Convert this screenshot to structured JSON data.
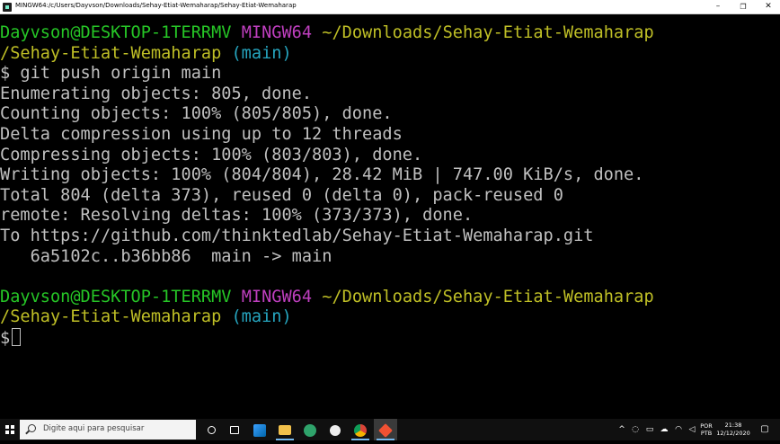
{
  "window": {
    "title": "MINGW64:/c/Users/Dayvson/Downloads/Sehay-Etiat-Wemaharap/Sehay-Etiat-Wemaharap",
    "minimize_label": "–",
    "maximize_label": "❐",
    "close_label": "✕"
  },
  "terminal": {
    "prompt1": {
      "user": "Dayvson@DESKTOP-1TERRMV",
      "shell": "MINGW64",
      "path": "~/Downloads/Sehay-Etiat-Wemaharap",
      "path_cont": "/Sehay-Etiat-Wemaharap",
      "branch": "(main)"
    },
    "command": "$ git push origin main",
    "output": [
      "Enumerating objects: 805, done.",
      "Counting objects: 100% (805/805), done.",
      "Delta compression using up to 12 threads",
      "Compressing objects: 100% (803/803), done.",
      "Writing objects: 100% (804/804), 28.42 MiB | 747.00 KiB/s, done.",
      "Total 804 (delta 373), reused 0 (delta 0), pack-reused 0",
      "remote: Resolving deltas: 100% (373/373), done.",
      "To https://github.com/thinktedlab/Sehay-Etiat-Wemaharap.git",
      "   6a5102c..b36bb86  main -> main"
    ],
    "prompt2": {
      "user": "Dayvson@DESKTOP-1TERRMV",
      "shell": "MINGW64",
      "path": "~/Downloads/Sehay-Etiat-Wemaharap",
      "path_cont": "/Sehay-Etiat-Wemaharap",
      "branch": "(main)"
    },
    "current_prompt": "$",
    "colors": {
      "user": "#26c626",
      "shell": "#bf3fbf",
      "path": "#bfbf26",
      "branch": "#26a5bf",
      "text": "#c0c0c0"
    }
  },
  "taskbar": {
    "search_placeholder": "Digite aqui para pesquisar",
    "icons": [
      "cortana-icon",
      "task-view-icon",
      "vscode-icon",
      "file-explorer-icon",
      "app-icon",
      "media-icon",
      "chrome-icon",
      "git-bash-icon"
    ],
    "tray": {
      "chevron": "^",
      "language_top": "POR",
      "language_bottom": "PTB",
      "time": "21:38",
      "date": "12/12/2020"
    }
  }
}
